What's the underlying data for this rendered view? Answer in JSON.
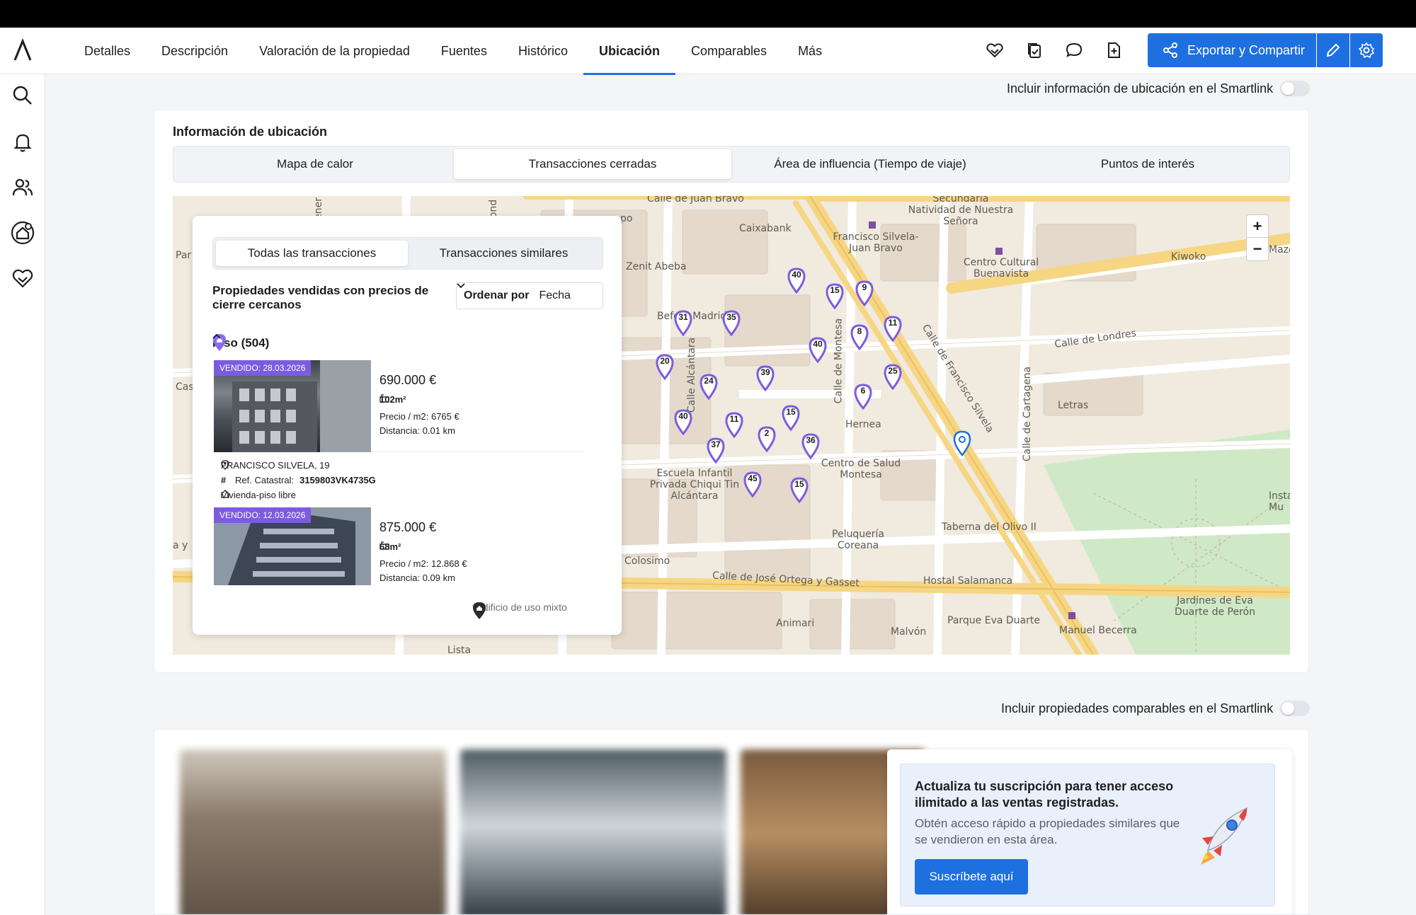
{
  "nav": {
    "tabs": [
      "Detalles",
      "Descripción",
      "Valoración de la propiedad",
      "Fuentes",
      "Histórico",
      "Ubicación",
      "Comparables",
      "Más"
    ],
    "active_tab": "Ubicación",
    "export_label": "Exportar y Compartir",
    "icons": [
      "handshake-icon",
      "documents-check-icon",
      "chat-icon",
      "add-file-icon"
    ]
  },
  "sidebar": {
    "icons": [
      "search-icon",
      "bell-icon",
      "users-icon",
      "home-search-icon",
      "handshake-icon"
    ]
  },
  "location": {
    "smartlink_toggle": "Incluir información de ubicación en el Smartlink",
    "title": "Información de ubicación",
    "tabs": [
      "Mapa de calor",
      "Transacciones cerradas",
      "Área de influencia (Tiempo de viaje)",
      "Puntos de interés"
    ],
    "active_tab": "Transacciones cerradas"
  },
  "panel": {
    "tabs": [
      "Todas las transacciones",
      "Transacciones similares"
    ],
    "heading": "Propiedades vendidas con precios de cierre cercanos",
    "sort_label": "Ordenar por",
    "sort_value": "Fecha",
    "group": "Piso (504)",
    "listings": [
      {
        "badge": "VENDIDO: 28.03.2026",
        "price": "690.000 €",
        "area": "102m²",
        "price_m2": "Precio / m2: 6765 €",
        "distance": "Distancia: 0.01 km",
        "address": "FRANCISCO SILVELA, 19",
        "ref_label": "Ref. Catastral:",
        "ref": "3159803VK4735G",
        "type": "Vivienda-piso libre"
      },
      {
        "badge": "VENDIDO: 12.03.2026",
        "price": "875.000 €",
        "area": "68m²",
        "price_m2": "Precio / m2: 12.868 €",
        "distance": "Distancia: 0.09 km"
      }
    ],
    "footnote": "*Edificio de uso mixto"
  },
  "map": {
    "labels": [
      "Calle de Juan Bravo",
      "Secundaria Natividad de Nuestra Señora",
      "Caixabank",
      "Francisco Silvela-Juan Bravo",
      "Zenit Abeba",
      "Centro Cultural Buenavista",
      "Kiwoko",
      "Before Madrid",
      "Calle de Londres",
      "Letras",
      "Calle de Cartagena",
      "Calle de Francisco Silvela",
      "Calle de Montesa",
      "Calle Alcántara",
      "Hernea",
      "Centro de Salud Montesa",
      "Escuela Infantil Privada Chiqui Tin Alcántara",
      "Taberna del Olivo II",
      "Peluquería Coreana",
      "Colosimo",
      "Calle de José Ortega y Gasset",
      "Hostal Salamanca",
      "Animari",
      "Malvón",
      "Parque Eva Duarte",
      "Manuel Becerra",
      "Jardines de Eva Duarte de Perón",
      "Lista",
      "Cas",
      "Par",
      "Insta Mu",
      "Mazd",
      "po",
      "ener",
      "ond",
      "a y"
    ],
    "pins": [
      "40",
      "15",
      "9",
      "31",
      "35",
      "8",
      "11",
      "40",
      "20",
      "24",
      "39",
      "25",
      "6",
      "40",
      "11",
      "15",
      "2",
      "36",
      "37",
      "45",
      "15"
    ]
  },
  "comparables": {
    "smartlink_toggle": "Incluir propiedades comparables en el Smartlink",
    "promo_title": "Actualiza tu suscripción para tener acceso ilimitado a las ventas registradas.",
    "promo_desc": "Obtén acceso rápido a propiedades similares que se vendieron en esta área.",
    "promo_button": "Suscríbete aquí"
  },
  "colors": {
    "accent": "#1e6fe0",
    "sold_badge": "#7b5ce0",
    "pin": "#7b5ce0"
  }
}
